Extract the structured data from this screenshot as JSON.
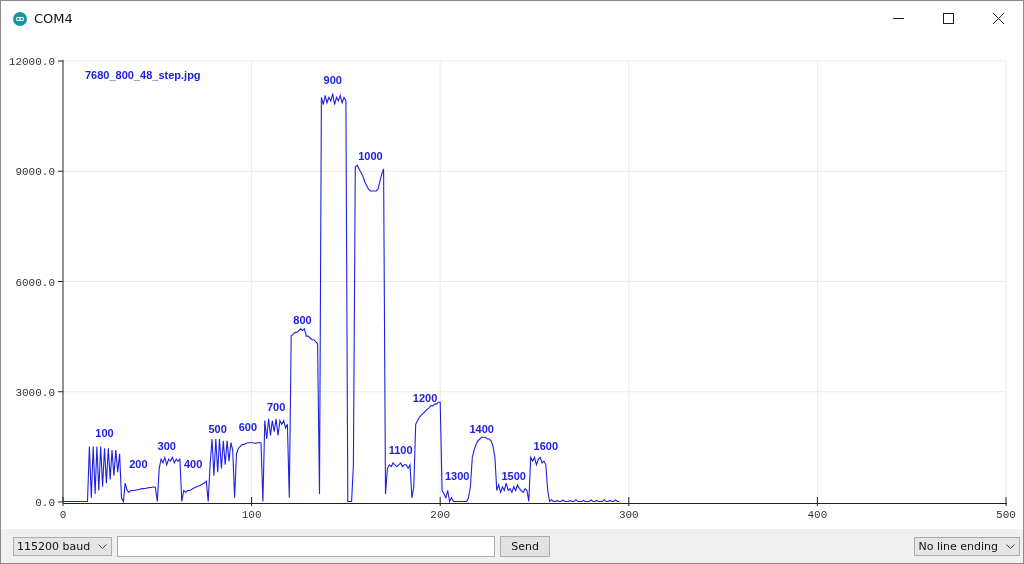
{
  "window": {
    "title": "COM4"
  },
  "plot": {
    "chart_data": {
      "type": "line",
      "grid": true,
      "xlim": [
        0,
        500
      ],
      "ylim": [
        0,
        12000
      ],
      "x": [
        0,
        1,
        2,
        3,
        4,
        5,
        6,
        7,
        8,
        9,
        10,
        11,
        12,
        13,
        14,
        15,
        16,
        17,
        18,
        19,
        20,
        21,
        22,
        23,
        24,
        25,
        26,
        27,
        28,
        29,
        30,
        31,
        32,
        33,
        34,
        35,
        36,
        37,
        38,
        39,
        40,
        41,
        42,
        43,
        44,
        45,
        46,
        47,
        48,
        49,
        50,
        51,
        52,
        53,
        54,
        55,
        56,
        57,
        58,
        59,
        60,
        61,
        62,
        63,
        64,
        65,
        66,
        67,
        68,
        69,
        70,
        71,
        72,
        73,
        74,
        75,
        76,
        77,
        78,
        79,
        80,
        81,
        82,
        83,
        84,
        85,
        86,
        87,
        88,
        89,
        90,
        91,
        92,
        93,
        94,
        95,
        96,
        97,
        98,
        99,
        100,
        101,
        102,
        103,
        104,
        105,
        106,
        107,
        108,
        109,
        110,
        111,
        112,
        113,
        114,
        115,
        116,
        117,
        118,
        119,
        120,
        121,
        122,
        123,
        124,
        125,
        126,
        127,
        128,
        129,
        130,
        131,
        132,
        133,
        134,
        135,
        136,
        137,
        138,
        139,
        140,
        141,
        142,
        143,
        144,
        145,
        146,
        147,
        148,
        149,
        150,
        151,
        152,
        153,
        154,
        155,
        156,
        157,
        158,
        159,
        160,
        161,
        162,
        163,
        164,
        165,
        166,
        167,
        168,
        169,
        170,
        171,
        172,
        173,
        174,
        175,
        176,
        177,
        178,
        179,
        180,
        181,
        182,
        183,
        184,
        185,
        186,
        187,
        188,
        189,
        190,
        191,
        192,
        193,
        194,
        195,
        196,
        197,
        198,
        199,
        200,
        201,
        202,
        203,
        204,
        205,
        206,
        207,
        208,
        209,
        210,
        211,
        212,
        213,
        214,
        215,
        216,
        217,
        218,
        219,
        220,
        221,
        222,
        223,
        224,
        225,
        226,
        227,
        228,
        229,
        230,
        231,
        232,
        233,
        234,
        235,
        236,
        237,
        238,
        239,
        240,
        241,
        242,
        243,
        244,
        245,
        246,
        247,
        248,
        249,
        250,
        251,
        252,
        253,
        254,
        255,
        256,
        257,
        258,
        259,
        260,
        261,
        262,
        263,
        264,
        265,
        266,
        267,
        268,
        269,
        270,
        271,
        272,
        273,
        274,
        275,
        276,
        277,
        278,
        279,
        280,
        281,
        282,
        283,
        284,
        285,
        286,
        287,
        288,
        289,
        290,
        291,
        292,
        293,
        294,
        295
      ],
      "xticks": [
        0,
        100,
        200,
        300,
        400,
        500
      ],
      "yticks": [
        {
          "value": 0,
          "label": "0.0"
        },
        {
          "value": 3000,
          "label": "3000.0"
        },
        {
          "value": 6000,
          "label": "6000.0"
        },
        {
          "value": 9000,
          "label": "9000.0"
        },
        {
          "value": 12000,
          "label": "12000.0"
        }
      ],
      "series": [
        {
          "name": "7680_800_48_step.jpg",
          "color": "#2020e0",
          "values": [
            0,
            0,
            0,
            0,
            0,
            0,
            0,
            0,
            0,
            0,
            0,
            0,
            0,
            0,
            1500,
            100,
            1500,
            200,
            1500,
            300,
            1500,
            400,
            1450,
            500,
            1450,
            600,
            1400,
            700,
            1400,
            800,
            1300,
            100,
            0,
            500,
            300,
            250,
            300,
            300,
            300,
            320,
            320,
            340,
            350,
            350,
            360,
            370,
            380,
            380,
            400,
            380,
            0,
            900,
            1150,
            1050,
            1200,
            1000,
            1150,
            1100,
            1200,
            1050,
            1150,
            1100,
            1150,
            0,
            300,
            250,
            300,
            300,
            320,
            350,
            380,
            400,
            420,
            450,
            480,
            500,
            550,
            0,
            1000,
            1700,
            700,
            1700,
            800,
            1700,
            900,
            1650,
            1000,
            1650,
            1100,
            1600,
            1400,
            100,
            1300,
            1450,
            1500,
            1550,
            1550,
            1580,
            1600,
            1600,
            1600,
            1600,
            1580,
            1600,
            1600,
            1600,
            0,
            2200,
            1700,
            2250,
            1800,
            2200,
            1900,
            2250,
            1800,
            2200,
            2100,
            2200,
            2000,
            2100,
            100,
            4500,
            4550,
            4600,
            4600,
            4650,
            4700,
            4650,
            4700,
            4500,
            4500,
            4450,
            4400,
            4400,
            4350,
            4300,
            200,
            11000,
            10800,
            11050,
            10850,
            11000,
            10900,
            11100,
            10800,
            11000,
            10900,
            11050,
            10850,
            11000,
            10900,
            0,
            0,
            0,
            1000,
            9100,
            9150,
            9050,
            8950,
            8850,
            8700,
            8600,
            8500,
            8450,
            8450,
            8450,
            8450,
            8500,
            8700,
            8900,
            9050,
            200,
            900,
            1000,
            950,
            1050,
            1000,
            950,
            1000,
            1050,
            950,
            1000,
            1000,
            900,
            1000,
            100,
            400,
            2100,
            2200,
            2300,
            2350,
            2400,
            2450,
            2500,
            2550,
            2600,
            2600,
            2650,
            2650,
            2700,
            2700,
            300,
            200,
            100,
            300,
            0,
            100,
            0,
            0,
            0,
            0,
            0,
            0,
            0,
            0,
            100,
            400,
            1200,
            1400,
            1550,
            1650,
            1700,
            1750,
            1750,
            1750,
            1700,
            1700,
            1650,
            1500,
            1200,
            300,
            450,
            250,
            400,
            300,
            500,
            300,
            350,
            250,
            400,
            300,
            450,
            350,
            300,
            250,
            350,
            300,
            0,
            1200,
            1100,
            1200,
            1000,
            1150,
            1200,
            1050,
            1100,
            1000,
            300,
            0,
            50,
            0,
            0,
            30,
            0,
            0,
            40,
            0,
            0,
            0,
            30,
            0,
            0,
            50,
            0,
            0,
            0,
            30,
            0,
            0,
            0,
            40,
            0,
            0,
            30,
            0,
            0,
            0,
            50,
            0,
            0,
            30,
            0,
            0,
            40,
            0,
            0
          ]
        }
      ],
      "annotations": [
        "100",
        "200",
        "300",
        "400",
        "500",
        "600",
        "700",
        "800",
        "900",
        "1000",
        "1100",
        "1200",
        "1300",
        "1400",
        "1500",
        "1600"
      ]
    }
  },
  "controls": {
    "baud": "115200 baud",
    "send": "Send",
    "line_ending": "No line ending"
  }
}
